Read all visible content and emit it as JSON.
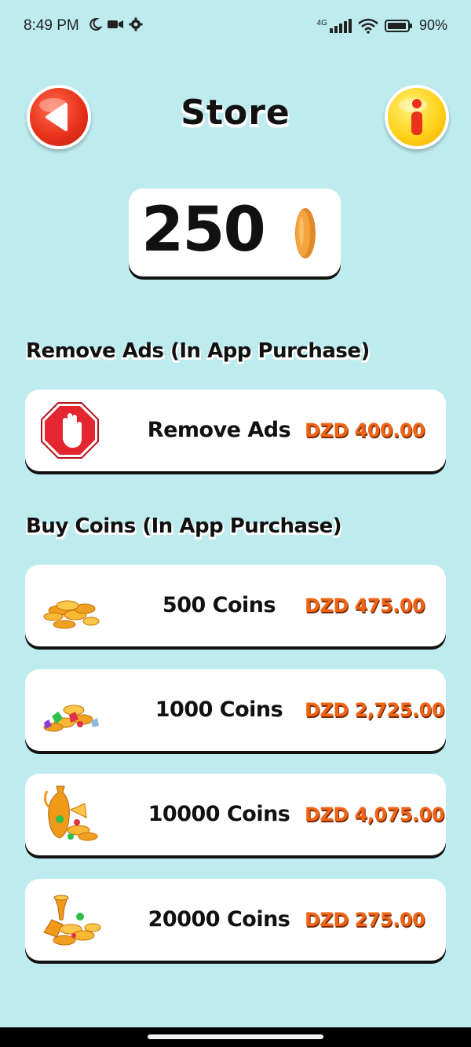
{
  "status_bar": {
    "time": "8:49 PM",
    "network": "4G",
    "battery": "90%"
  },
  "header": {
    "title": "Store",
    "back_icon": "back-arrow-icon",
    "info_icon": "info-icon"
  },
  "balance": {
    "coins": "250",
    "icon": "coin-icon"
  },
  "sections": {
    "remove_ads_title": "Remove Ads (In App Purchase)",
    "buy_coins_title": "Buy Coins (In App Purchase)"
  },
  "items": [
    {
      "label": "Remove Ads",
      "price": "DZD 400.00",
      "icon": "stop-hand-icon"
    },
    {
      "label": "500 Coins",
      "price": "DZD 475.00",
      "icon": "coin-pile-icon"
    },
    {
      "label": "1000 Coins",
      "price": "DZD 2,725.00",
      "icon": "coins-gems-icon"
    },
    {
      "label": "10000 Coins",
      "price": "DZD 4,075.00",
      "icon": "treasure-vase-icon"
    },
    {
      "label": "20000 Coins",
      "price": "DZD 275.00",
      "icon": "treasure-pile-icon"
    }
  ],
  "colors": {
    "background": "#bdebee",
    "price": "#f06416",
    "back_button": "#e8321c",
    "info_button": "#ffd21a"
  }
}
